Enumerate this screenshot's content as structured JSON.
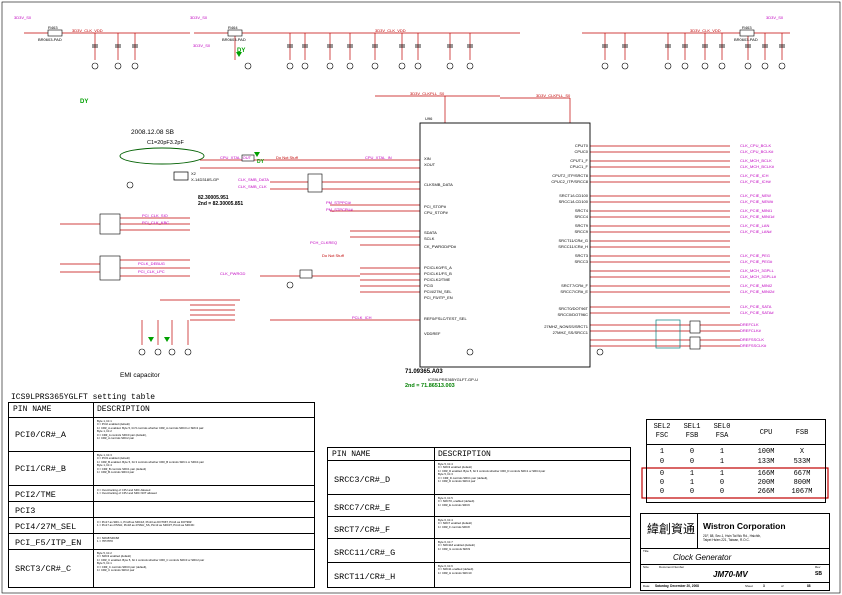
{
  "header_labels": {
    "net_3d3v_s0_a": "3D3V_S0",
    "net_3d3v_s0_b": "3D3V_S0",
    "net_3d3v_s0_c": "3D3V_S0",
    "net_3d3v_s0_d": "3D3V_S0",
    "bead_left": "BR0603-PAD",
    "bead_mid": "BR0603-PAD",
    "bead_right": "BR0603-PAD",
    "ref_r463": "R463",
    "ref_r464": "R464",
    "ref_r463b": "R463",
    "dy_label_1": "DY",
    "dy_label_2": "DY",
    "dy_label_3": "DY"
  },
  "top_nets": {
    "vdd_clk_1": "3D3V_CLK_VDD",
    "vdd_clk_2": "3D3V_CLK_VDD",
    "vdd_clk_3": "3D3V_CLK_VDD",
    "vdd_cpu_1": "3D3V_CLKPLL_S0",
    "vdd_cpu_2": "3D3V_CLKPLL_S0"
  },
  "annotations": {
    "date_note": "2008.12.08 SB",
    "cap_note": "C1=20pF3.2pF",
    "second_source_1": "82.30005.951",
    "second_source_2": "2nd = 82.30005.851",
    "chip_pn": "71.09365.A03",
    "chip_second": "2nd = 71.86513.003",
    "chip_name": "ICS9LPRS365YGLFT-GP-U",
    "emi_caption": "EMI capacitor",
    "u_ref": "U96",
    "do_not_stuff_1": "Do Not Stuff",
    "do_not_stuff_2": "Do Not Stuff",
    "xtal_ref": "X2",
    "xtal_pn": "X-14D318S-GP"
  },
  "left_nets": {
    "net1": "CPU_XTAL_OUT",
    "net2": "CPU_XTAL_IN",
    "net3": "CLK_SMB_DATA",
    "net4": "CLK_SMB_CLK",
    "net5": "PCI_CLK_SIO",
    "net6": "PCI_CLK_KBC",
    "net7": "PCLK_DEBUG",
    "net8": "PCI_CLK_LPC",
    "net9": "PM_STPPCI#",
    "net10": "PM_STPCPU#",
    "net11": "PCH_CLKREQ",
    "net12": "PCLK_ICH",
    "net13": "CLK_PWRGD"
  },
  "right_outputs": [
    "CLK_CPU_BCLK",
    "CLK_CPU_BCLK#",
    "CLK_MCH_BCLK",
    "CLK_MCH_BCLK#",
    "CLK_PCIE_ICH",
    "CLK_PCIE_ICH#",
    "CLK_PCIE_NEW",
    "CLK_PCIE_NEW#",
    "CLK_PCIE_MINI1",
    "CLK_PCIE_MINI1#",
    "CLK_PCIE_LAN",
    "CLK_PCIE_LAN#",
    "CLK_PCIE_PEG",
    "CLK_PCIE_PEG#",
    "CLK_MCH_3GPLL",
    "CLK_MCH_3GPLL#",
    "CLK_PCIE_MINI2",
    "CLK_PCIE_MINI2#",
    "CLK_PCIE_SATA",
    "CLK_PCIE_SATA#",
    "DREFCLK",
    "DREFCLK#",
    "DREFSSCLK",
    "DREFSSCLK#"
  ],
  "chip_pins_left": [
    "XIN",
    "XOUT",
    "CLKSMB_DATA",
    "CLKSMB_CLK",
    "PCI_STOP#",
    "CPU_STOP#",
    "SDATA",
    "SCLK",
    "CK_PWRGD/PD#",
    "PCICLK0/FS_A",
    "PCICLK1/FS_B",
    "PCICLK2/TME",
    "PCI3",
    "PCI4/27M_SEL",
    "PCI_F5/ITP_EN",
    "REF0/FSLC/TEST_SEL",
    "VDDREF"
  ],
  "chip_pins_right": [
    "CPUT0",
    "CPUC0",
    "CPUT1_F",
    "CPUC1_F",
    "CPUT2_ITP/SRCT8",
    "CPUC2_ITP/SRCC8",
    "SRCT1/LCD100",
    "SRCC1/LCD100",
    "SRCT4",
    "SRCC4",
    "SRCT9",
    "SRCC9",
    "SRCT11/CR#_G",
    "SRCC11/CR#_H",
    "SRCT3",
    "SRCC3",
    "SRCT7/CR#_F",
    "SRCC7/CR#_E",
    "SRCT0/DOT96T",
    "SRCC0/DOT96C",
    "27MHZ_NONSS/SRCT1",
    "27MHZ_SS/SRCC1"
  ],
  "setting_table": {
    "title": "ICS9LPRS365YGLFT setting table",
    "col_pin": "PIN NAME",
    "col_desc": "DESCRIPTION",
    "rows": [
      {
        "pin": "PCI0/CR#_A",
        "desc": "Byte 1, bit 1\n0 = PCI2 enabled (default)\n1= CR#_A enabled. Byte 5, bit 5 controls whether CR#_A controls SRC0 or SRC2 pair\nByte 1, bit 2\n0 = CR#_A controls SRC0 pair (default),\n1= CR#_A controls SRC2 pair"
      },
      {
        "pin": "PCI1/CR#_B",
        "desc": "Byte 1, bit 3\n0 = PCI3 enabled (default)\n1= CR#_B enabled. Byte 5, bit 3 controls whether CR#_B controls SRC1 or SRC4 pair\nByte 1, bit 4\n0 = CR#_B controls SRC1 pair (default)\n1= CR#_B controls SRC4 pair"
      },
      {
        "pin": "PCI2/TME",
        "desc": "0 = Overclocking of CPU and SRC Allowed\n1 = Overclocking of CPU and SRC NOT allowed"
      },
      {
        "pin": "PCI3",
        "desc": ""
      },
      {
        "pin": "PCI4/27M_SEL",
        "desc": "0 = Pin17 as SRC-1, Pin18 as SRC1#, Pin13 as DOT96T, Pin14 as DOT96#\n1 = Pin17 as 27MHz, Pin18 as 27MHz_SS, Pin13 as SRC0T, Pin14 as SRC0C"
      },
      {
        "pin": "PCI_F5/ITP_EN",
        "desc": "0 = SRC8/SRC8#\n1 = ITP/ITP#"
      },
      {
        "pin": "SRCT3/CR#_C",
        "desc": "Byte 5, bit 2\n0 = SRC3 enabled (default)\n1= CR#_C enabled. Byte 5, bit 1 controls whether CR#_C controls SRC0 or SRC2 pair\nByte 5, bit 1\n0 = CR#_C controls SRC0 pair (default),\n1= CR#_C controls SRC2 pair"
      }
    ]
  },
  "setting_table_2": {
    "col_pin": "PIN NAME",
    "col_desc": "DESCRIPTION",
    "rows": [
      {
        "pin": "SRCC3/CR#_D",
        "desc": "Byte 5, bit 4\n0 = SRC3 enabled (default)\n1= CR#_D enabled. Byte 5, bit 3 controls whether CR#_D controls SRC1 or SRC4 pair\nByte 5, bit 3\n0 = CR#_D controls SRC1 pair (default),\n1= CR#_D controls SRC4 pair"
      },
      {
        "pin": "SRCC7/CR#_E",
        "desc": "Byte 6, bit 5\n0 = SRC7#, enabled (default)\n1= CR#_E controls SRC6"
      },
      {
        "pin": "SRCT7/CR#_F",
        "desc": "Byte 6, bit 4\n0 = SRC7 enabled (default)\n1= CR#_F controls SRC8"
      },
      {
        "pin": "SRCC11/CR#_G",
        "desc": "Byte 6, bit 7\n0 = SRC11# enabled (default)\n1= CR#_G controls SRC9"
      },
      {
        "pin": "SRCT11/CR#_H",
        "desc": "Byte 6, bit 6\n0 = SRC11 enabled (default)\n1= CR#_H controls SRC10"
      }
    ]
  },
  "freq_table": {
    "headers": [
      "SEL2\nFSC",
      "SEL1\nFSB",
      "SEL0\nFSA",
      "CPU",
      "FSB"
    ],
    "rows": [
      [
        "1",
        "0",
        "1",
        "100M",
        "X"
      ],
      [
        "0",
        "0",
        "1",
        "133M",
        "533M"
      ],
      [
        "0",
        "1",
        "1",
        "166M",
        "667M"
      ],
      [
        "0",
        "1",
        "0",
        "200M",
        "800M"
      ],
      [
        "0",
        "0",
        "0",
        "266M",
        "1067M"
      ]
    ]
  },
  "title_block": {
    "company_cn": "緯創資通",
    "company": "Wistron Corporation",
    "address": "21F, 88, Sec.1, Hsin Tai Wu Rd., Hsichih,\nTaipei Hsien 221, Taiwan, R.O.C.",
    "title_label": "Title",
    "title": "Clock Generator",
    "size_label": "Size",
    "doc_label": "Document Number",
    "doc": "JM70-MV",
    "rev_label": "Rev",
    "rev": "SB",
    "date_label": "Date:",
    "date": "Saturday, December 20, 2008",
    "sheet_label": "Sheet",
    "sheet": "3",
    "of_label": "of",
    "of": "88"
  },
  "colors": {
    "wire": "#c00000",
    "net": "#c000c0",
    "green": "#00a000",
    "ink": "#000000"
  }
}
